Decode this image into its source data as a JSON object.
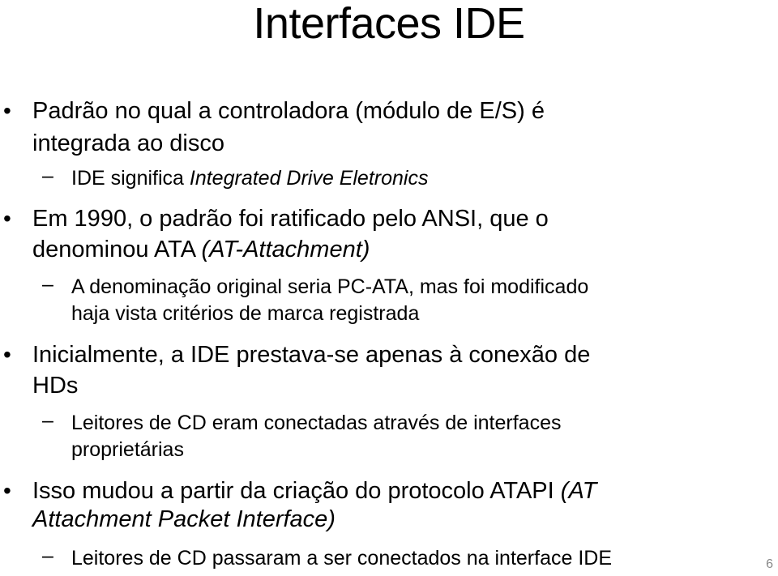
{
  "slide": {
    "title": "Interfaces IDE",
    "page_number": "6",
    "bullets": [
      {
        "text_line1": "Padrão no qual a controladora (módulo de E/S) é",
        "text_line2": "integrada ao disco",
        "sub": [
          {
            "text": "IDE significa ",
            "italic": "Integrated Drive Eletronics"
          }
        ]
      },
      {
        "text_line1": "Em 1990, o padrão foi ratificado pelo ANSI, que o",
        "text_line2": "denominou ATA ",
        "italic_line2": "(AT-Attachment)",
        "sub": [
          {
            "line1": "A denominação original seria PC-ATA, mas foi modificado",
            "line2": "haja vista critérios de marca registrada"
          }
        ]
      },
      {
        "text_line1": "Inicialmente, a IDE prestava-se apenas à conexão de",
        "text_line2": "HDs",
        "sub": [
          {
            "line1": "Leitores de CD eram conectadas através de interfaces",
            "line2": "proprietárias"
          }
        ]
      },
      {
        "text_line1": "Isso mudou a partir da criação do protocolo ATAPI",
        "italic_line1": "(AT",
        "italic_line2": "Attachment Packet Interface)",
        "sub": [
          {
            "text": "Leitores de CD passaram a ser conectados na interface IDE"
          }
        ]
      }
    ]
  }
}
